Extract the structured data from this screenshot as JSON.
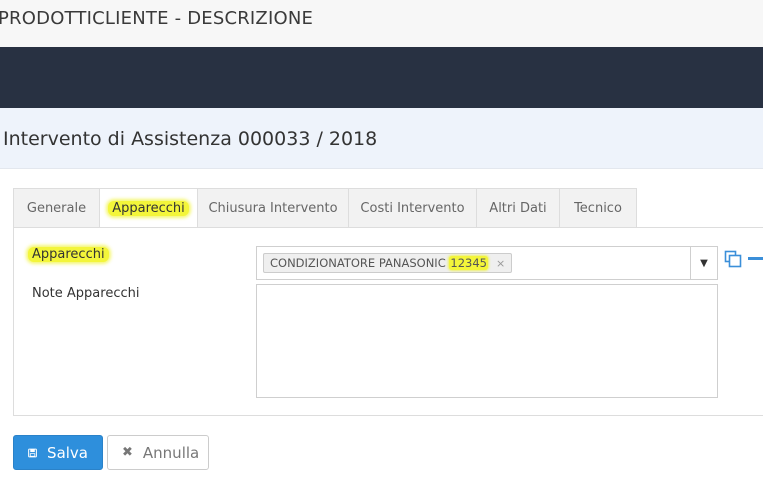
{
  "app_title": "PRODOTTICLIENTE - DESCRIZIONE",
  "page_title": "Intervento di Assistenza 000033 / 2018",
  "tabs": [
    {
      "label": "Generale"
    },
    {
      "label": "Apparecchi"
    },
    {
      "label": "Chiusura Intervento"
    },
    {
      "label": "Costi Intervento"
    },
    {
      "label": "Altri Dati"
    },
    {
      "label": "Tecnico"
    }
  ],
  "active_tab": "Apparecchi",
  "form": {
    "apparecchi_label": "Apparecchi",
    "selected_item_prefix": "CONDIZIONATORE PANASONIC ",
    "selected_item_code": "12345",
    "remove_glyph": "×",
    "note_label": "Note Apparecchi",
    "note_value": ""
  },
  "buttons": {
    "save_label": "Salva",
    "cancel_label": "Annulla"
  },
  "icons": {
    "dropdown": "caret-down-icon",
    "copy": "copy-icon",
    "remove_row": "minus-icon",
    "save": "floppy-disk-icon",
    "cancel": "times-icon"
  },
  "colors": {
    "topbar": "#283142",
    "header_band": "#eef3fb",
    "primary": "#2e8fdc",
    "highlight": "#f3f53a"
  }
}
